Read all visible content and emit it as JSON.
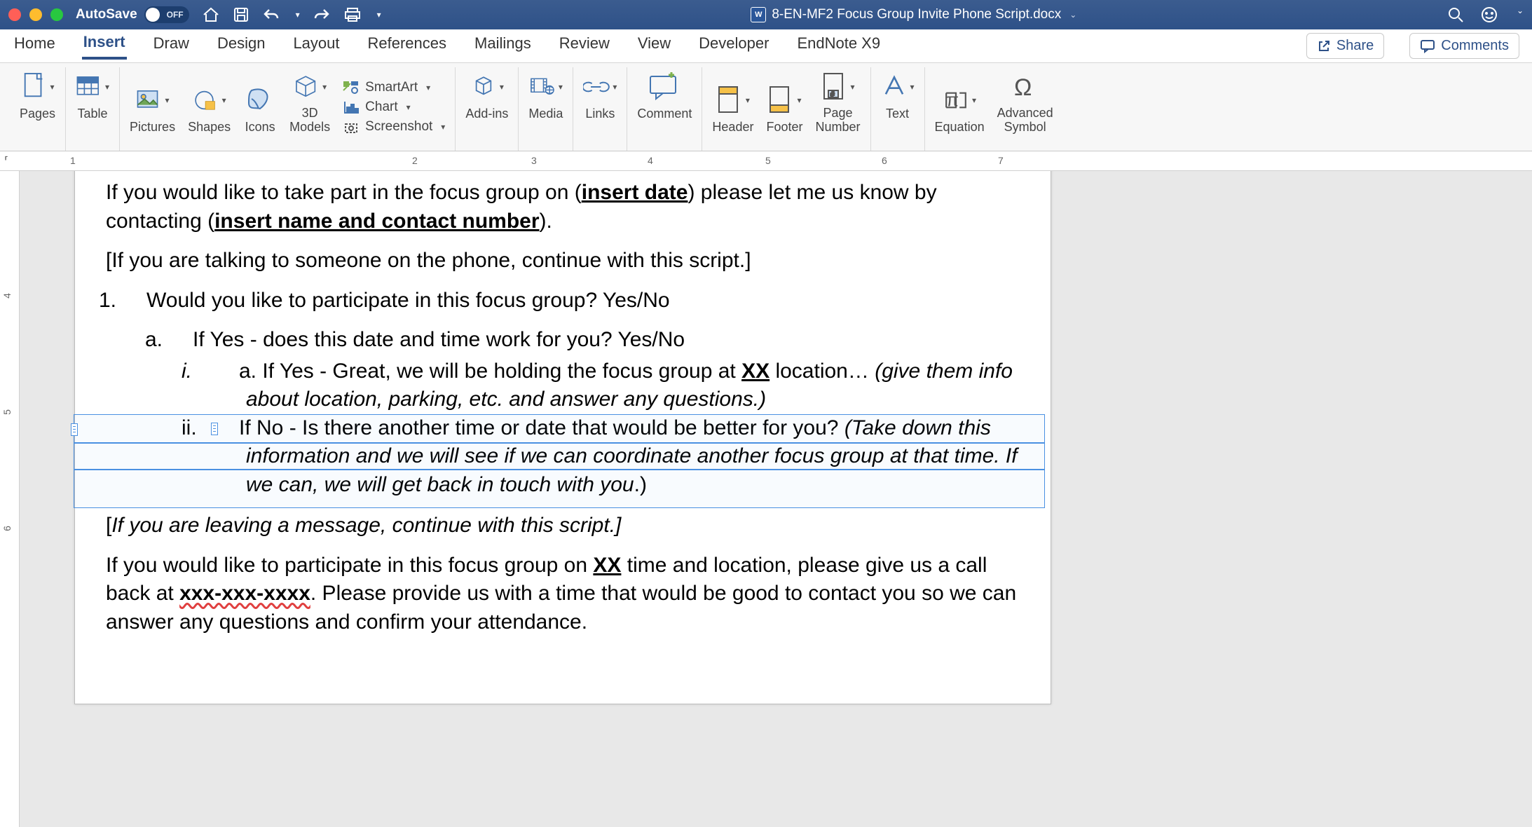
{
  "titlebar": {
    "autosave_label": "AutoSave",
    "autosave_state": "OFF",
    "filename": "8-EN-MF2 Focus Group Invite Phone Script.docx"
  },
  "tabs": {
    "items": [
      "Home",
      "Insert",
      "Draw",
      "Design",
      "Layout",
      "References",
      "Mailings",
      "Review",
      "View",
      "Developer",
      "EndNote X9"
    ],
    "active_index": 1,
    "share": "Share",
    "comments": "Comments"
  },
  "ribbon": {
    "pages": "Pages",
    "table": "Table",
    "pictures": "Pictures",
    "shapes": "Shapes",
    "icons": "Icons",
    "models": "3D Models",
    "smartart": "SmartArt",
    "chart": "Chart",
    "screenshot": "Screenshot",
    "addins": "Add-ins",
    "media": "Media",
    "links": "Links",
    "comment": "Comment",
    "header": "Header",
    "footer": "Footer",
    "pagenum": "Page Number",
    "text": "Text",
    "equation": "Equation",
    "symbol": "Advanced Symbol"
  },
  "ruler": {
    "h": [
      "1",
      "2",
      "3",
      "4",
      "5",
      "6",
      "7"
    ],
    "v": [
      "4",
      "5",
      "6"
    ]
  },
  "doc": {
    "p1_a": "If you would like to take part in the focus group on (",
    "p1_date": "insert date",
    "p1_b": ") please let me us know by contacting (",
    "p1_contact": "insert name and contact number",
    "p1_c": ").",
    "p2": "[If you are talking to someone on the phone, continue with this script.]",
    "q1_num": "1.",
    "q1": "Would you like to participate in this focus group? Yes/No",
    "qa_num": "a.",
    "qa": "If Yes - does this date and time work for you? Yes/No",
    "qi_num": "i.",
    "qi_a": "a. If Yes - Great, we will be holding the focus group at ",
    "qi_xx": "XX",
    "qi_b": " location… ",
    "qi_it": "(give them info about location, parking, etc. and answer any questions.)",
    "qii_num": "ii.",
    "qii_a": "If No - Is there another time or date that would be better for you?  ",
    "qii_it": "(Take down this information and we will see if we can coordinate another focus group at that time. If we can, we will get back in touch with you",
    "qii_b": ".)",
    "p3_a": "[",
    "p3_it": "If you are leaving a message, continue with this script.]",
    "p4_a": "If you would like to participate in this focus group on ",
    "p4_xx": "XX",
    "p4_b": " time and location, please give us a call back at ",
    "p4_phone": "xxx-xxx-xxxx",
    "p4_c": ". Please provide us with a time that would be good to contact you so we can answer any questions and confirm your attendance."
  }
}
